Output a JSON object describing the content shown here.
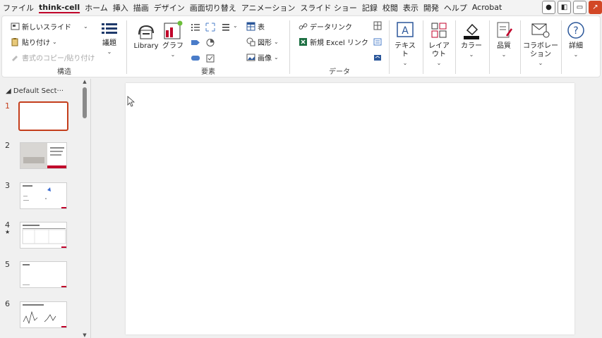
{
  "menu": {
    "items": [
      "ファイル",
      "think-cell",
      "ホーム",
      "挿入",
      "描画",
      "デザイン",
      "画面切り替え",
      "アニメーション",
      "スライド ショー",
      "記録",
      "校閲",
      "表示",
      "開発",
      "ヘルプ",
      "Acrobat"
    ],
    "active_index": 1
  },
  "ribbon": {
    "struct": {
      "new_slide": "新しいスライド",
      "paste": "貼り付け",
      "copy_paste_format": "書式のコピー/貼り付け",
      "agenda": "議題",
      "label": "構造"
    },
    "elements": {
      "library": "Library",
      "graph": "グラフ",
      "table": "表",
      "shape": "図形",
      "image": "画像",
      "label": "要素"
    },
    "data": {
      "data_link": "データリンク",
      "new_excel_link": "新規 Excel リンク",
      "label": "データ"
    },
    "text": "テキスト",
    "layout": [
      "レイア",
      "ウト"
    ],
    "color": "カラー",
    "quality": "品質",
    "collab": [
      "コラボレー",
      "ション"
    ],
    "details": "詳細"
  },
  "slides_pane": {
    "section_title": "Default Sect···",
    "slides": [
      {
        "num": "1",
        "selected": true
      },
      {
        "num": "2",
        "selected": false
      },
      {
        "num": "3",
        "selected": false
      },
      {
        "num": "4",
        "selected": false,
        "star": "★"
      },
      {
        "num": "5",
        "selected": false
      },
      {
        "num": "6",
        "selected": false
      }
    ]
  },
  "colors": {
    "accent": "#c43e1c",
    "brand_underline": "#c0002a"
  }
}
